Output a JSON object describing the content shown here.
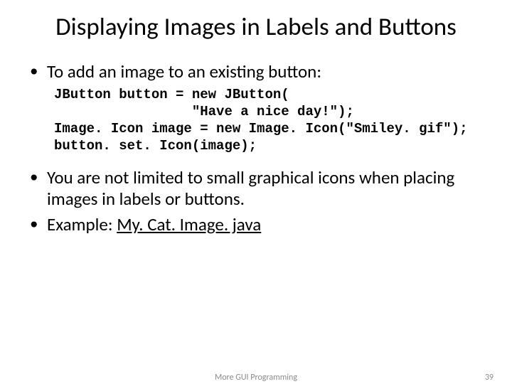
{
  "title": "Displaying Images in Labels and Buttons",
  "bullets": {
    "b1": "To add an image to an existing button:",
    "b2": "You are not limited to small graphical icons when placing images in labels or buttons.",
    "b3_prefix": "Example: ",
    "b3_link": "My. Cat. Image. java"
  },
  "code": "JButton button = new JButton(\n                 \"Have a nice day!\");\nImage. Icon image = new Image. Icon(\"Smiley. gif\");\nbutton. set. Icon(image);",
  "footer": {
    "center": "More GUI Programming",
    "page": "39"
  }
}
